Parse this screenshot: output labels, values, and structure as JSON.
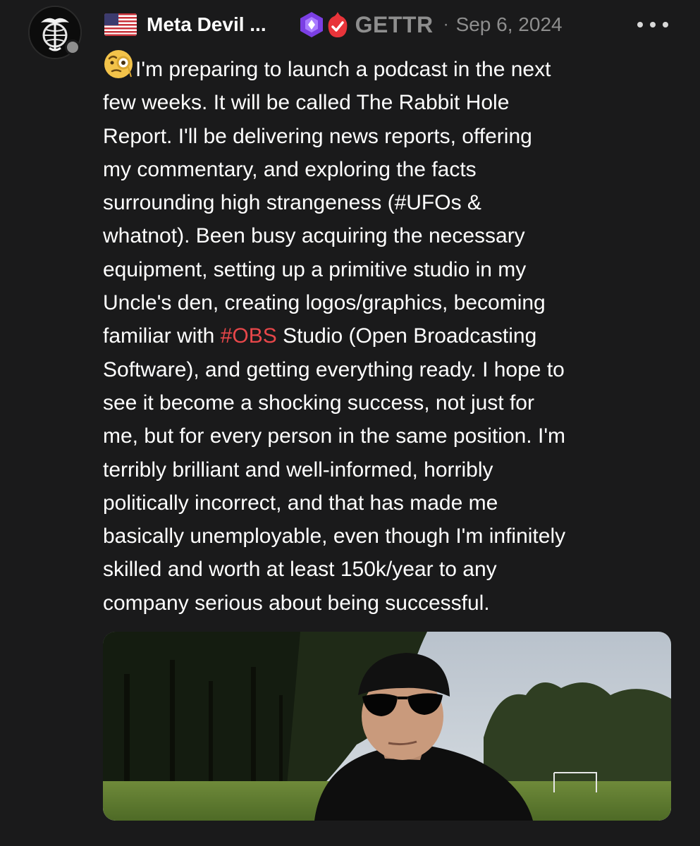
{
  "author": {
    "display_name": "Meta Devil ...",
    "flag_icon": "us-flag-icon",
    "avatar_icon": "eagle-globe-anchor-emblem-icon",
    "badges": [
      "purple-hexagon-badge-icon",
      "red-verified-flame-badge-icon"
    ]
  },
  "post": {
    "source": "GETTR",
    "separator": "·",
    "date": "Sep 6, 2024",
    "more_icon": "more-horizontal-icon",
    "emoji_icon": "face-with-monocle-emoji",
    "lines": [
      "I'm preparing to launch a podcast in the next",
      "few weeks. It will be called The Rabbit Hole",
      "Report. I'll be delivering news reports, offering",
      "my commentary, and exploring the facts",
      "surrounding high strangeness (#UFOs &",
      "whatnot). Been busy acquiring the necessary",
      "equipment, setting up a primitive studio in my",
      "Uncle's den, creating logos/graphics, becoming"
    ],
    "line_9_before": "familiar with ",
    "line_9_hashtag": "#OBS",
    "line_9_after": " Studio (Open Broadcasting",
    "lines_after": [
      "Software), and getting everything ready. I hope to",
      "see it become a shocking success, not just for",
      "me, but for every person in the same position. I'm",
      "terribly brilliant and well-informed, horribly",
      "politically incorrect, and that has made me",
      "basically unemployable, even though I'm infinitely",
      "skilled and worth at least 150k/year to any",
      "company serious about being successful."
    ]
  },
  "colors": {
    "background": "#1a1a1b",
    "text": "#ffffff",
    "muted": "#8e8e8e",
    "hashtag": "#e8474a",
    "badge_purple": "#7b3fe4",
    "badge_red": "#e8343a"
  }
}
